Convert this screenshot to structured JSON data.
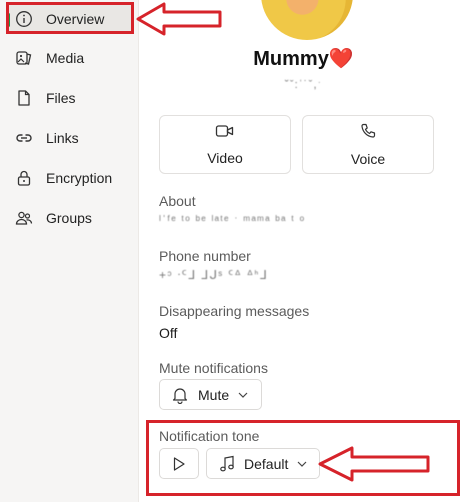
{
  "sidebar": {
    "items": [
      {
        "label": "Overview",
        "icon": "info-icon",
        "active": true
      },
      {
        "label": "Media",
        "icon": "media-icon"
      },
      {
        "label": "Files",
        "icon": "file-icon"
      },
      {
        "label": "Links",
        "icon": "link-icon"
      },
      {
        "label": "Encryption",
        "icon": "lock-icon"
      },
      {
        "label": "Groups",
        "icon": "people-icon"
      }
    ]
  },
  "contact": {
    "name": "Mummy",
    "name_emoji": "❤️",
    "subtitle": "˘ˇ:ˈ˙ˇ,ˑ"
  },
  "actions": {
    "video_label": "Video",
    "voice_label": "Voice"
  },
  "about": {
    "label": "About",
    "value": "ˡˈᶠᵉ ᵗᵒ ᵇᵉ ˡᵃᵗᵉ ˑ ᵐᵃᵐᵃ ᵇᵃ ᵗ ᵒ"
  },
  "phone": {
    "label": "Phone number",
    "value": "+ᵓ ᐧᑦᒧ ᒧᒍˢ ᑦᐞ ᐞᑋᒧ"
  },
  "disappearing": {
    "label": "Disappearing messages",
    "value": "Off"
  },
  "mute": {
    "label": "Mute notifications",
    "button_label": "Mute"
  },
  "tone": {
    "label": "Notification tone",
    "selected": "Default"
  },
  "colors": {
    "accent_green": "#1a9b4a",
    "annotation_red": "#d6232a"
  }
}
